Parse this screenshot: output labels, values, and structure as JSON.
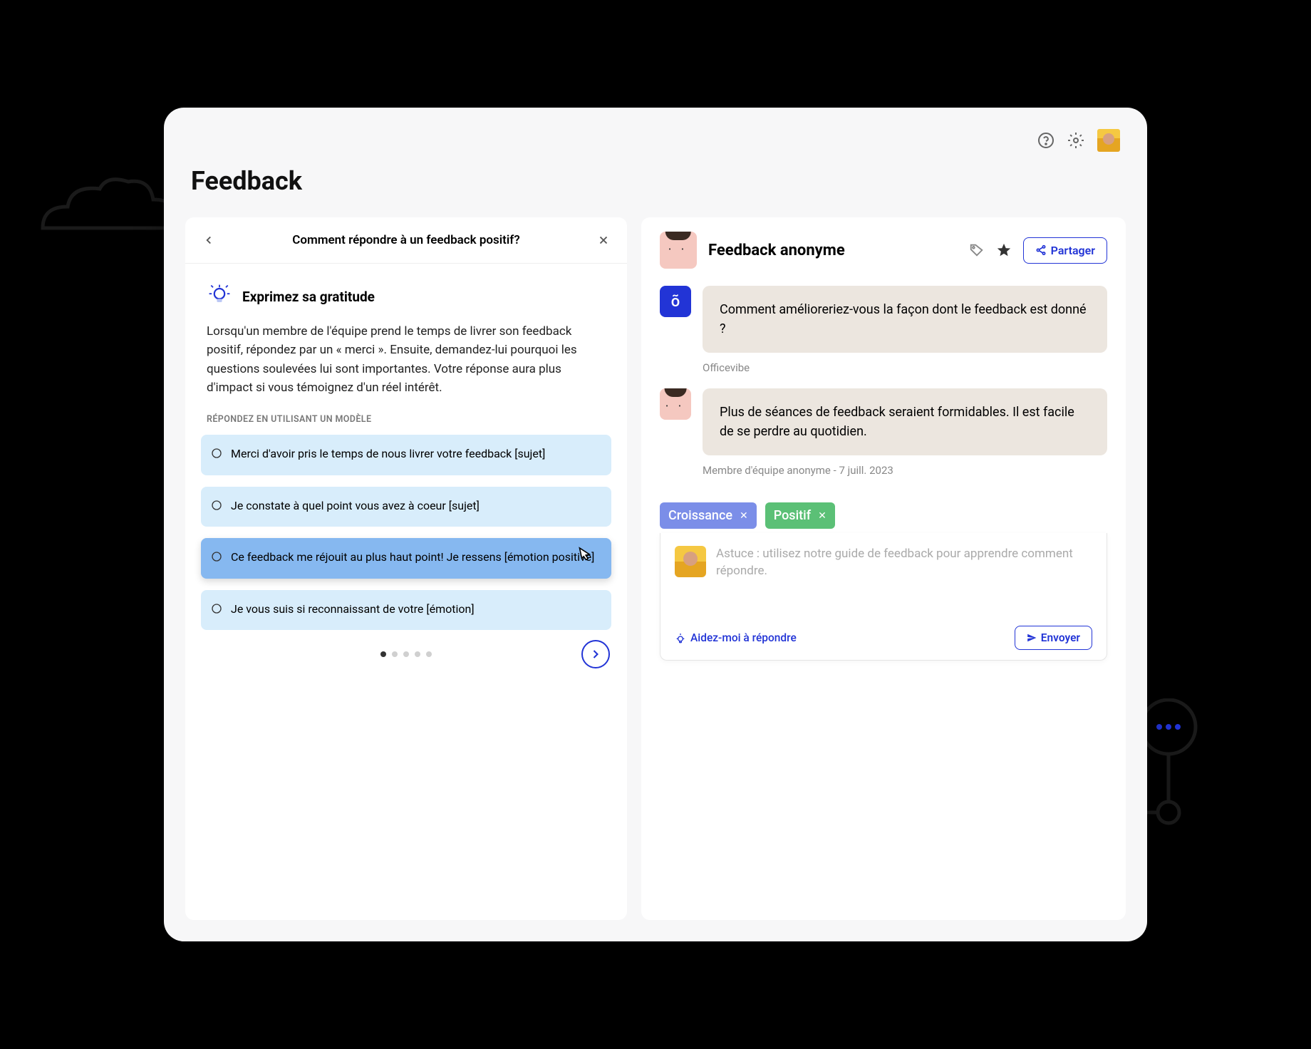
{
  "page_title": "Feedback",
  "left": {
    "header_title": "Comment répondre à un feedback positif?",
    "tip_title": "Exprimez sa gratitude",
    "tip_text": "Lorsqu'un membre de l'équipe prend le temps de livrer son feedback positif, répondez par un « merci ». Ensuite, demandez-lui pourquoi les questions soulevées lui sont importantes. Votre réponse aura plus d'impact si vous témoignez d'un réel intérêt.",
    "tip_subhead": "RÉPONDEZ EN UTILISANT UN MODÈLE",
    "templates": [
      "Merci d'avoir pris le temps de nous livrer votre feedback [sujet]",
      "Je constate à quel point vous avez à coeur [sujet]",
      "Ce feedback me réjouit au plus haut point! Je ressens [émotion positive]",
      "Je vous suis si reconnaissant de votre [émotion]"
    ],
    "selected_index": 2,
    "page_count": 5,
    "active_page": 0
  },
  "right": {
    "title": "Feedback anonyme",
    "share_label": "Partager",
    "messages": [
      {
        "sender": "officevibe",
        "text": "Comment amélioreriez-vous la façon dont le feedback est donné ?",
        "meta": "Officevibe"
      },
      {
        "sender": "anon",
        "text": "Plus de séances de feedback seraient formidables. Il est facile de se perdre au quotidien.",
        "meta_author": "Membre d'équipe anonyme",
        "meta_date": "7 juill. 2023"
      }
    ],
    "tags": [
      {
        "label": "Croissance",
        "color": "blue"
      },
      {
        "label": "Positif",
        "color": "green"
      }
    ],
    "composer_placeholder": "Astuce : utilisez notre guide de feedback pour apprendre comment répondre.",
    "help_label": "Aidez-moi à répondre",
    "send_label": "Envoyer"
  }
}
